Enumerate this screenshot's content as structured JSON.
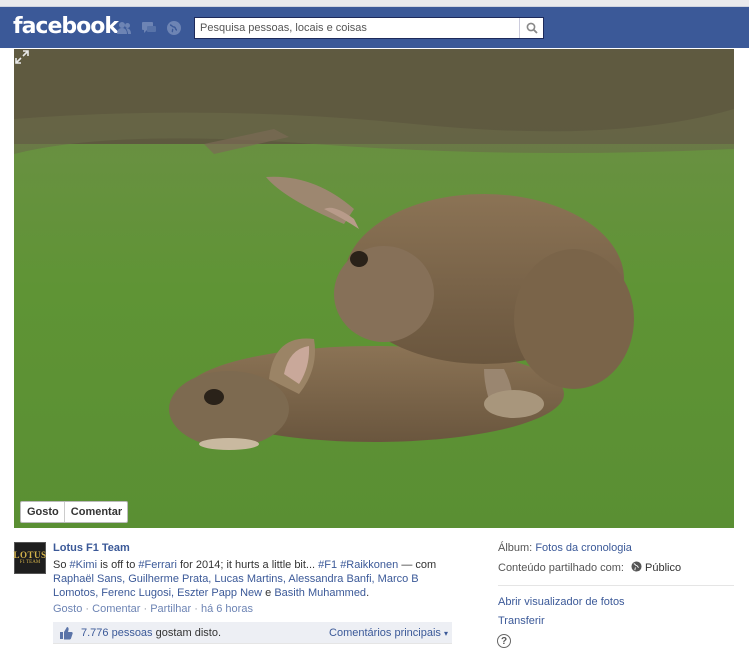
{
  "header": {
    "logo": "facebook",
    "search_placeholder": "Pesquisa pessoas, locais e coisas",
    "icons": [
      "friend-requests-icon",
      "messages-icon",
      "notifications-globe-icon",
      "search-icon"
    ],
    "brand_color": "#3b5998"
  },
  "photo": {
    "expand_icon": "expand-icon",
    "like_label": "Gosto",
    "comment_label": "Comentar"
  },
  "post": {
    "avatar_text_line1": "LOTUS",
    "avatar_text_line2": "F1 TEAM",
    "author": "Lotus F1 Team",
    "text_1": "So ",
    "tag_kimi": "#Kimi",
    "text_2": " is off to ",
    "tag_ferrari": "#Ferrari",
    "text_3": " for 2014; it hurts a little bit... ",
    "tag_f1": "#F1",
    "tag_raikkonen": "#Raikkonen",
    "text_4": " — com",
    "tagged_people": "Raphaël Sans, Guilherme Prata, Lucas Martins, Alessandra Banfi, Marco B Lomotos, Ferenc Lugosi, Eszter Papp New",
    "tagged_joiner": " e ",
    "tagged_last": "Basith Muhammed",
    "tagged_end": ".",
    "actions": {
      "like": "Gosto",
      "comment": "Comentar",
      "share": "Partilhar",
      "time": "há 6 horas",
      "separator": " · "
    },
    "likes_count": "7.776 pessoas",
    "likes_suffix": " gostam disto.",
    "comments_filter": "Comentários principais"
  },
  "sidebar": {
    "album_label": "Álbum:",
    "album_value": "Fotos da cronologia",
    "shared_label": "Conteúdo partilhado com:",
    "shared_value": "Público",
    "open_viewer": "Abrir visualizador de fotos",
    "download": "Transferir",
    "help_icon": "?"
  }
}
